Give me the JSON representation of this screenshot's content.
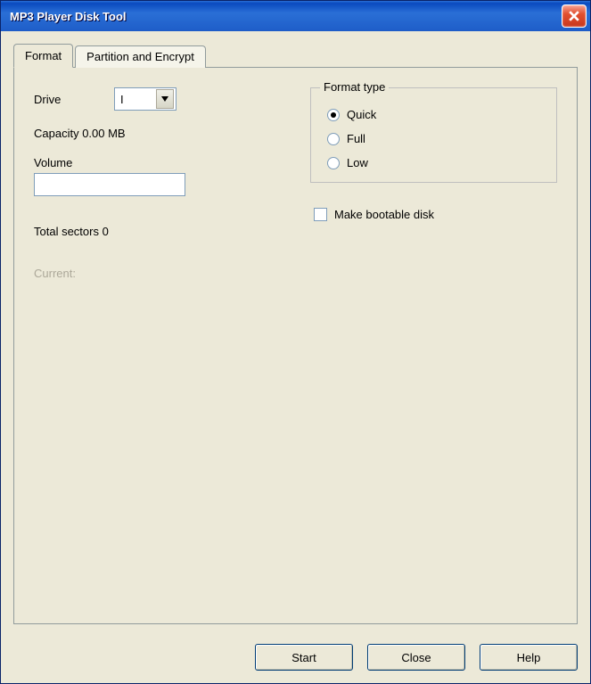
{
  "window": {
    "title": "MP3 Player Disk Tool"
  },
  "tabs": {
    "format": "Format",
    "partition": "Partition and Encrypt"
  },
  "form": {
    "drive_label": "Drive",
    "drive_value": "I",
    "capacity_label": "Capacity 0.00 MB",
    "volume_label": "Volume",
    "volume_value": "",
    "total_sectors_label": "Total sectors 0",
    "current_label": "Current:"
  },
  "format_type": {
    "legend": "Format type",
    "quick": "Quick",
    "full": "Full",
    "low": "Low",
    "selected": "quick"
  },
  "bootable": {
    "label": "Make bootable disk",
    "checked": false
  },
  "buttons": {
    "start": "Start",
    "close": "Close",
    "help": "Help"
  }
}
